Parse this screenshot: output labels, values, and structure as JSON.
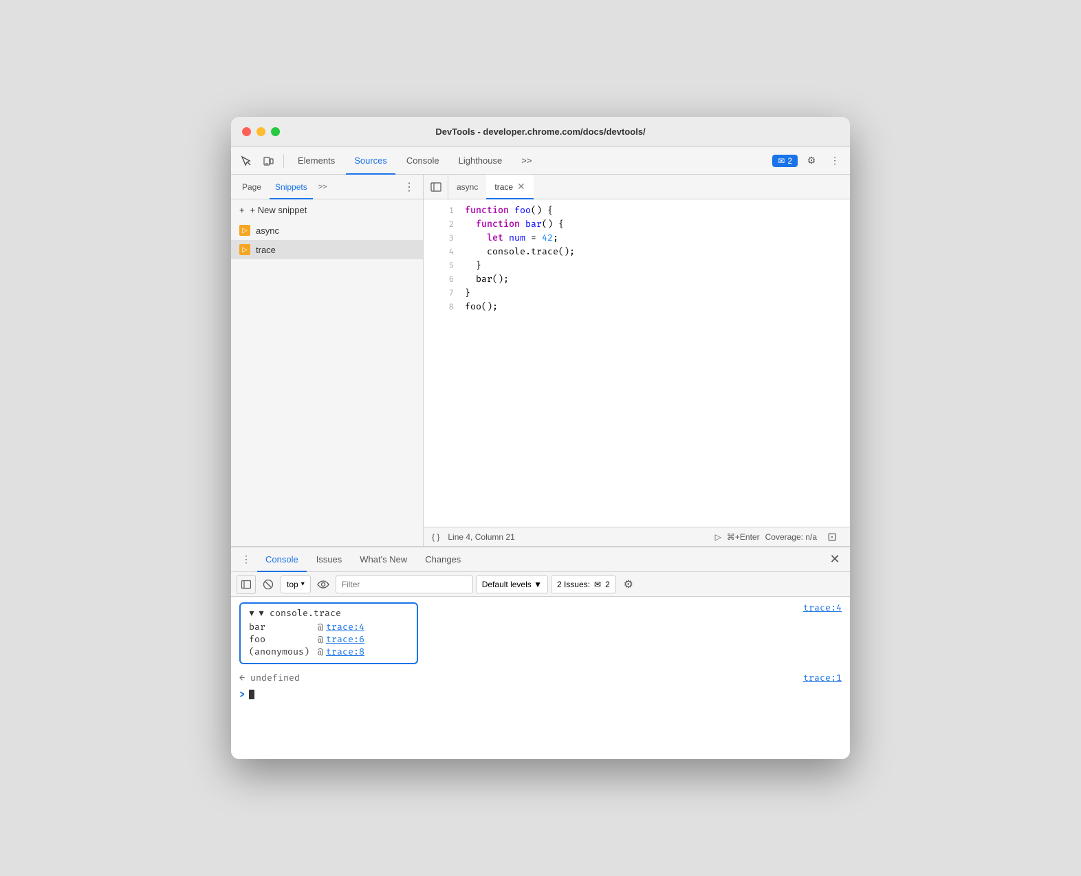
{
  "window": {
    "title": "DevTools - developer.chrome.com/docs/devtools/"
  },
  "titleBar": {
    "title": "DevTools - developer.chrome.com/docs/devtools/"
  },
  "mainToolbar": {
    "tabs": [
      {
        "id": "elements",
        "label": "Elements",
        "active": false
      },
      {
        "id": "sources",
        "label": "Sources",
        "active": true
      },
      {
        "id": "console",
        "label": "Console",
        "active": false
      },
      {
        "id": "lighthouse",
        "label": "Lighthouse",
        "active": false
      },
      {
        "id": "more",
        "label": ">>",
        "active": false
      }
    ],
    "issuesBadge": "2",
    "issuesLabel": "✉ 2"
  },
  "sidebar": {
    "tabs": [
      {
        "id": "page",
        "label": "Page",
        "active": false
      },
      {
        "id": "snippets",
        "label": "Snippets",
        "active": true
      },
      {
        "id": "more",
        "label": ">>",
        "active": false
      }
    ],
    "newSnippetLabel": "+ New snippet",
    "snippets": [
      {
        "id": "async",
        "label": "async",
        "active": false
      },
      {
        "id": "trace",
        "label": "trace",
        "active": true
      }
    ]
  },
  "editor": {
    "tabs": [
      {
        "id": "async",
        "label": "async",
        "active": false,
        "closeable": false
      },
      {
        "id": "trace",
        "label": "trace",
        "active": true,
        "closeable": true
      }
    ],
    "code": [
      {
        "line": 1,
        "content": "function foo() {"
      },
      {
        "line": 2,
        "content": "  function bar() {"
      },
      {
        "line": 3,
        "content": "    let num = 42;"
      },
      {
        "line": 4,
        "content": "    console.trace();"
      },
      {
        "line": 5,
        "content": "  }"
      },
      {
        "line": 6,
        "content": "  bar();"
      },
      {
        "line": 7,
        "content": "}"
      },
      {
        "line": 8,
        "content": "foo();"
      }
    ],
    "statusBar": {
      "braces": "{ }",
      "position": "Line 4, Column 21",
      "runShortcut": "⌘+Enter",
      "coverage": "Coverage: n/a"
    }
  },
  "bottomPanel": {
    "tabs": [
      {
        "id": "console",
        "label": "Console",
        "active": true
      },
      {
        "id": "issues",
        "label": "Issues",
        "active": false
      },
      {
        "id": "whats-new",
        "label": "What's New",
        "active": false
      },
      {
        "id": "changes",
        "label": "Changes",
        "active": false
      }
    ],
    "consoleToolbar": {
      "topSelector": "top",
      "filterPlaceholder": "Filter",
      "defaultLevelsLabel": "Default levels ▼",
      "issuesLabel": "2 Issues:",
      "issuesCount": "✉ 2"
    },
    "consoleOutput": {
      "traceEntry": {
        "header": "▼ console.trace",
        "ref": "trace:4",
        "rows": [
          {
            "func": "bar",
            "at": "@",
            "link": "trace:4"
          },
          {
            "func": "foo",
            "at": "@",
            "link": "trace:6"
          },
          {
            "func": "(anonymous)",
            "at": "@",
            "link": "trace:8"
          }
        ]
      },
      "undefinedLine": "← undefined",
      "undefinedRef": "trace:1",
      "promptSymbol": ">"
    }
  }
}
